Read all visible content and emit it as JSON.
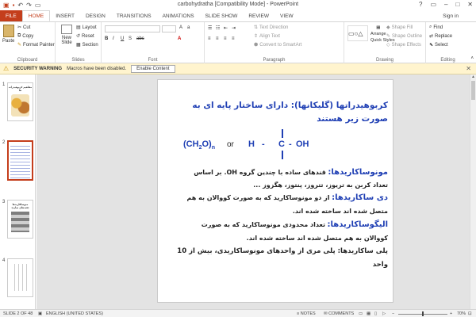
{
  "window": {
    "title": "carbohydratha [Compatibility Mode] - PowerPoint",
    "signin": "Sign in"
  },
  "tabs": [
    "FILE",
    "HOME",
    "INSERT",
    "DESIGN",
    "TRANSITIONS",
    "ANIMATIONS",
    "SLIDE SHOW",
    "REVIEW",
    "VIEW"
  ],
  "ribbon": {
    "clipboard": {
      "label": "Clipboard",
      "paste": "Paste",
      "cut": "Cut",
      "copy": "Copy",
      "format_painter": "Format Painter"
    },
    "slides": {
      "label": "Slides",
      "new_slide": "New Slide",
      "layout": "Layout",
      "reset": "Reset",
      "section": "Section"
    },
    "font": {
      "label": "Font"
    },
    "paragraph": {
      "label": "Paragraph",
      "text_direction": "Text Direction",
      "align_text": "Align Text",
      "convert_smartart": "Convert to SmartArt"
    },
    "drawing": {
      "label": "Drawing",
      "arrange": "Arrange",
      "quick_styles": "Quick Styles",
      "shape_fill": "Shape Fill",
      "shape_outline": "Shape Outline",
      "shape_effects": "Shape Effects"
    },
    "editing": {
      "label": "Editing",
      "find": "Find",
      "replace": "Replace",
      "select": "Select"
    }
  },
  "security": {
    "label": "SECURITY WARNING",
    "message": "Macros have been disabled.",
    "button": "Enable Content"
  },
  "thumbnails": [
    {
      "num": "1",
      "title": "مفاهیم کربوهیدرات ها"
    },
    {
      "num": "2",
      "title": ""
    },
    {
      "num": "3",
      "title": "منوساکاریدها (قندهای ساده)"
    },
    {
      "num": "4",
      "title": ""
    }
  ],
  "slide": {
    "title_line1": "کربوهیدراتها (گلیکانها): دارای ساختار پایه ای به",
    "title_line2": "صورت زیر هستند",
    "formula_left": "(CH",
    "formula_sub2": "2",
    "formula_mid": "O)",
    "formula_subn": "n",
    "formula_or": "or",
    "formula_h": "H",
    "formula_c": "C",
    "formula_oh": "OH",
    "formula_dash": "-",
    "formula_dash2": "-",
    "mono_term": "مونوساکاریدها:",
    "mono_text1": "قندهای ساده با چندین گروه OH. بر اساس",
    "mono_text2": "تعداد کربن به تریوز، تتروز، پنتوز، هگزوز ...",
    "di_term": "دی ساکاریدها:",
    "di_text1": "از دو مونوساکارید که به صورت کووالان به هم",
    "di_text2": "متصل شده اند ساخته شده اند.",
    "oligo_term": "الیگوساکاریدها:",
    "oligo_text1": "تعداد محدودی مونوساکارید که به صورت",
    "oligo_text2": "کووالان به هم متصل شده اند ساخته شده اند.",
    "poly_text1": "پلی ساکاریدها: پلی مری از واحدهای مونوساکاریدی، بیش از 10",
    "poly_text2": "واحد"
  },
  "status": {
    "slide": "SLIDE 2 OF 48",
    "language": "ENGLISH (UNITED STATES)",
    "notes": "NOTES",
    "comments": "COMMENTS",
    "zoom": "70%"
  },
  "colors": {
    "accent": "#c43e1c",
    "slide_title": "#1f3fb4"
  }
}
